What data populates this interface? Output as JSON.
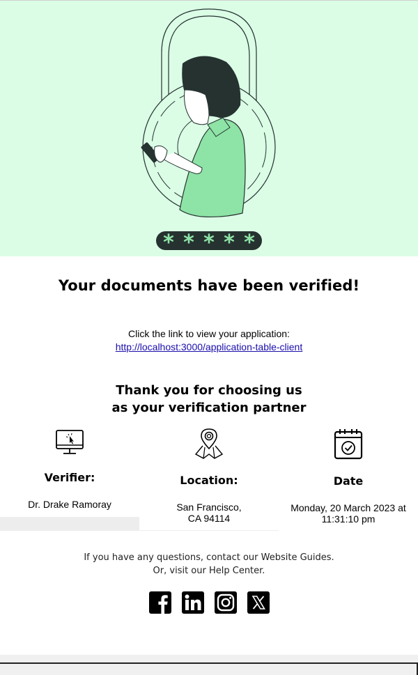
{
  "hero": {
    "illustration": "woman-with-phone-padlock-illustration",
    "password_mask": [
      "*",
      "*",
      "*",
      "*",
      "*"
    ],
    "colors": {
      "background": "#dbfde6",
      "accent": "#8ee3a6",
      "dark": "#253230"
    }
  },
  "heading": "Your documents have been verified!",
  "link_section": {
    "label": "Click the link to view your application:",
    "url": "http://localhost:3000/application-table-client"
  },
  "thanks": {
    "line1": "Thank you for choosing us",
    "line2": "as your verification partner"
  },
  "info": {
    "verifier": {
      "icon": "computer-icon",
      "title": "Verifier:",
      "value": "Dr. Drake Ramoray"
    },
    "location": {
      "icon": "location-map-icon",
      "title": "Location:",
      "value_line1": "San Francisco,",
      "value_line2": "CA 94114"
    },
    "date": {
      "icon": "calendar-check-icon",
      "title": "Date",
      "value_line1": "Monday, 20 March 2023 at",
      "value_line2": "11:31:10 pm"
    }
  },
  "help": {
    "line1": "If you have any questions, contact our Website  Guides.",
    "line2": "Or, visit our Help Center."
  },
  "social": [
    "facebook-icon",
    "linkedin-icon",
    "instagram-icon",
    "x-icon"
  ]
}
